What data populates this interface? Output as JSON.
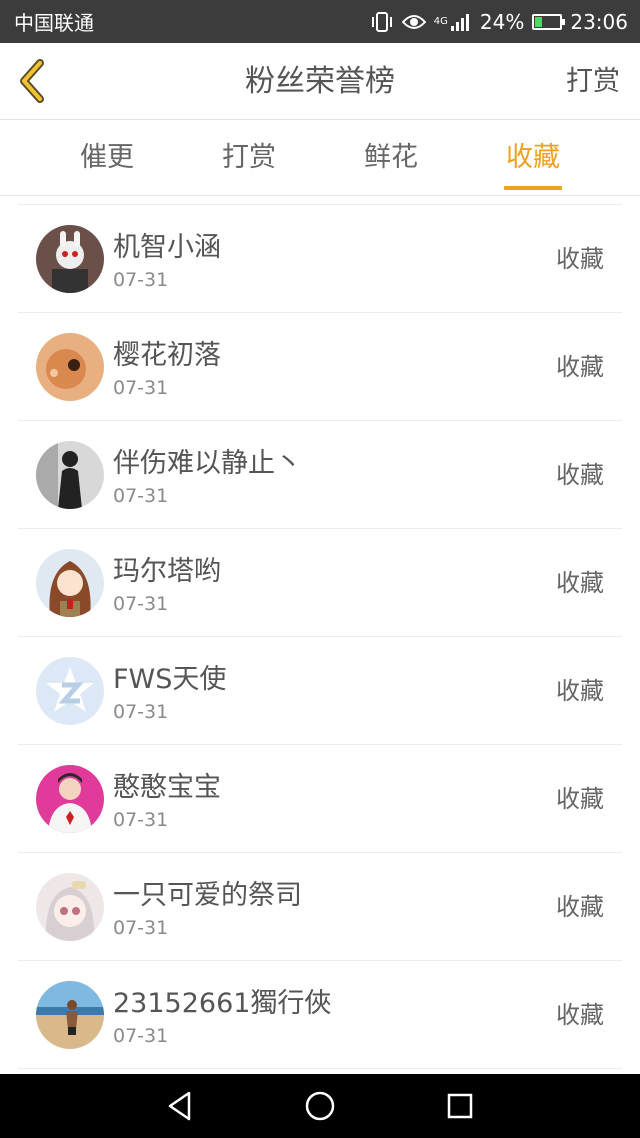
{
  "status_bar": {
    "carrier": "中国联通",
    "network": "4G",
    "battery": "24%",
    "battery_level": 0.24,
    "time": "23:06",
    "icons": [
      "vibrate-icon",
      "eye-icon",
      "signal-icon",
      "battery-icon"
    ]
  },
  "header": {
    "title": "粉丝荣誉榜",
    "action": "打赏",
    "back_icon": "chevron-left-icon"
  },
  "tabs": [
    {
      "label": "催更",
      "active": false
    },
    {
      "label": "打赏",
      "active": false
    },
    {
      "label": "鲜花",
      "active": false
    },
    {
      "label": "收藏",
      "active": true
    }
  ],
  "colors": {
    "accent": "#f0a020",
    "text": "#555555",
    "subtext": "#8a8a8a",
    "status_bar": "#3c3c3c"
  },
  "fans": [
    {
      "name": "机智小涵",
      "date": "07-31",
      "action": "收藏"
    },
    {
      "name": "樱花初落",
      "date": "07-31",
      "action": "收藏"
    },
    {
      "name": "伴伤难以静止丶",
      "date": "07-31",
      "action": "收藏"
    },
    {
      "name": "玛尔塔哟",
      "date": "07-31",
      "action": "收藏"
    },
    {
      "name": "FWS天使",
      "date": "07-31",
      "action": "收藏"
    },
    {
      "name": "憨憨宝宝",
      "date": "07-31",
      "action": "收藏"
    },
    {
      "name": "一只可爱的祭司",
      "date": "07-31",
      "action": "收藏"
    },
    {
      "name": "23152661獨行俠",
      "date": "07-31",
      "action": "收藏"
    }
  ],
  "nav": {
    "icons": [
      "back-triangle-icon",
      "home-circle-icon",
      "recents-square-icon"
    ]
  }
}
